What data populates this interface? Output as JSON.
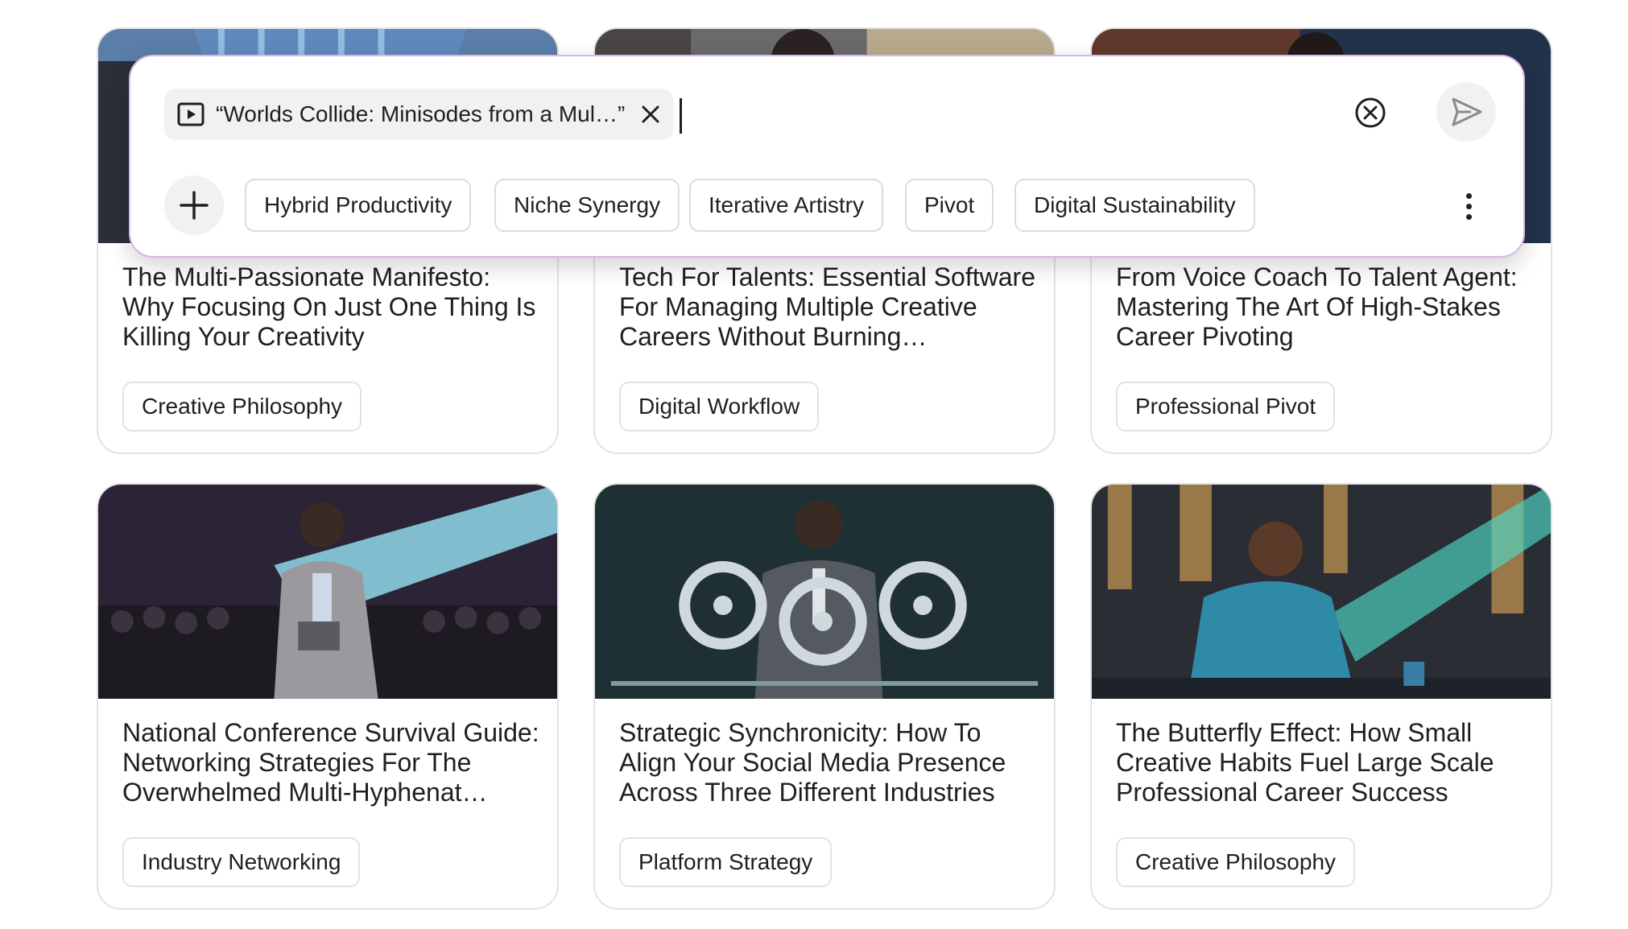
{
  "composer": {
    "attachment_label": "“Worlds Collide: Minisodes from a Mul…”",
    "suggestions": [
      "Hybrid Productivity",
      "Niche Synergy",
      "Iterative Artistry",
      "Pivot",
      "Digital Sustainability"
    ]
  },
  "cards": [
    {
      "title": "The Multi-Passionate Manifesto: Why Focusing On Just One Thing Is Killing Your Creativity",
      "tag": "Creative Philosophy"
    },
    {
      "title": "Tech For Talents: Essential Software For Managing Multiple Creative Careers Without Burning…",
      "tag": "Digital Workflow"
    },
    {
      "title": "From Voice Coach To Talent Agent: Mastering The Art Of High-Stakes Career Pivoting",
      "tag": "Professional Pivot"
    },
    {
      "title": "National Conference Survival Guide: Networking Strategies For The Overwhelmed Multi-Hyphenat…",
      "tag": "Industry Networking"
    },
    {
      "title": "Strategic Synchronicity: How To Align Your Social Media Presence Across Three Different Industries",
      "tag": "Platform Strategy"
    },
    {
      "title": "The Butterfly Effect: How Small Creative Habits Fuel Large Scale Professional Career Success",
      "tag": "Creative Philosophy"
    }
  ],
  "icons": {
    "attachment": "play-video-icon",
    "remove_attachment": "close-icon",
    "clear": "circle-x-icon",
    "send": "send-icon",
    "add": "plus-icon",
    "more": "more-vert-icon"
  }
}
